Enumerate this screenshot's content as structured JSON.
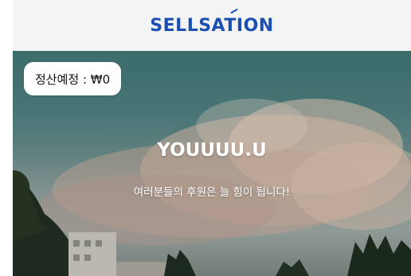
{
  "header": {
    "logo_text": "SELLSATION",
    "logo_color": "#1c4fb2"
  },
  "balance": {
    "text": "정산예정 : ₩0"
  },
  "profile": {
    "name": "YOUUUU.U",
    "message": "여러분들의 후원은 늘 힘이 됩니다!"
  }
}
